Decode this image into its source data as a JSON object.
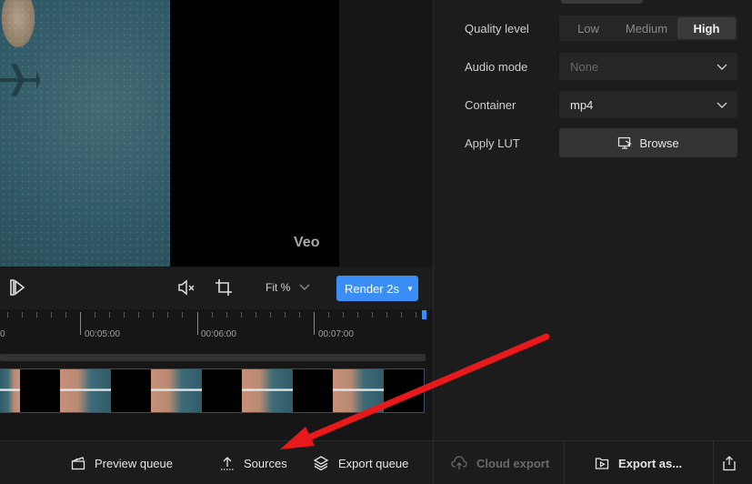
{
  "preview": {
    "watermark": "Veo"
  },
  "controls": {
    "fit_label": "Fit %",
    "render_label": "Render 2s",
    "next_frame_icon": "next-frame-icon",
    "mute_icon": "mute-icon",
    "crop_icon": "crop-icon"
  },
  "timeline": {
    "tick_labels": [
      "0",
      "00:05:00",
      "00:06:00",
      "00:07:00"
    ]
  },
  "settings": {
    "quality_label": "Quality level",
    "quality_options": [
      "Low",
      "Medium",
      "High"
    ],
    "quality_selected": "High",
    "audio_label": "Audio mode",
    "audio_value": "None",
    "container_label": "Container",
    "container_value": "mp4",
    "lut_label": "Apply LUT",
    "browse_label": "Browse"
  },
  "bottom_bar": {
    "preview_queue": "Preview queue",
    "sources": "Sources",
    "export_queue": "Export queue",
    "cloud_export": "Cloud export",
    "export_as": "Export as..."
  },
  "colors": {
    "accent": "#3a8ef6",
    "annotation_arrow": "#e8191a"
  }
}
